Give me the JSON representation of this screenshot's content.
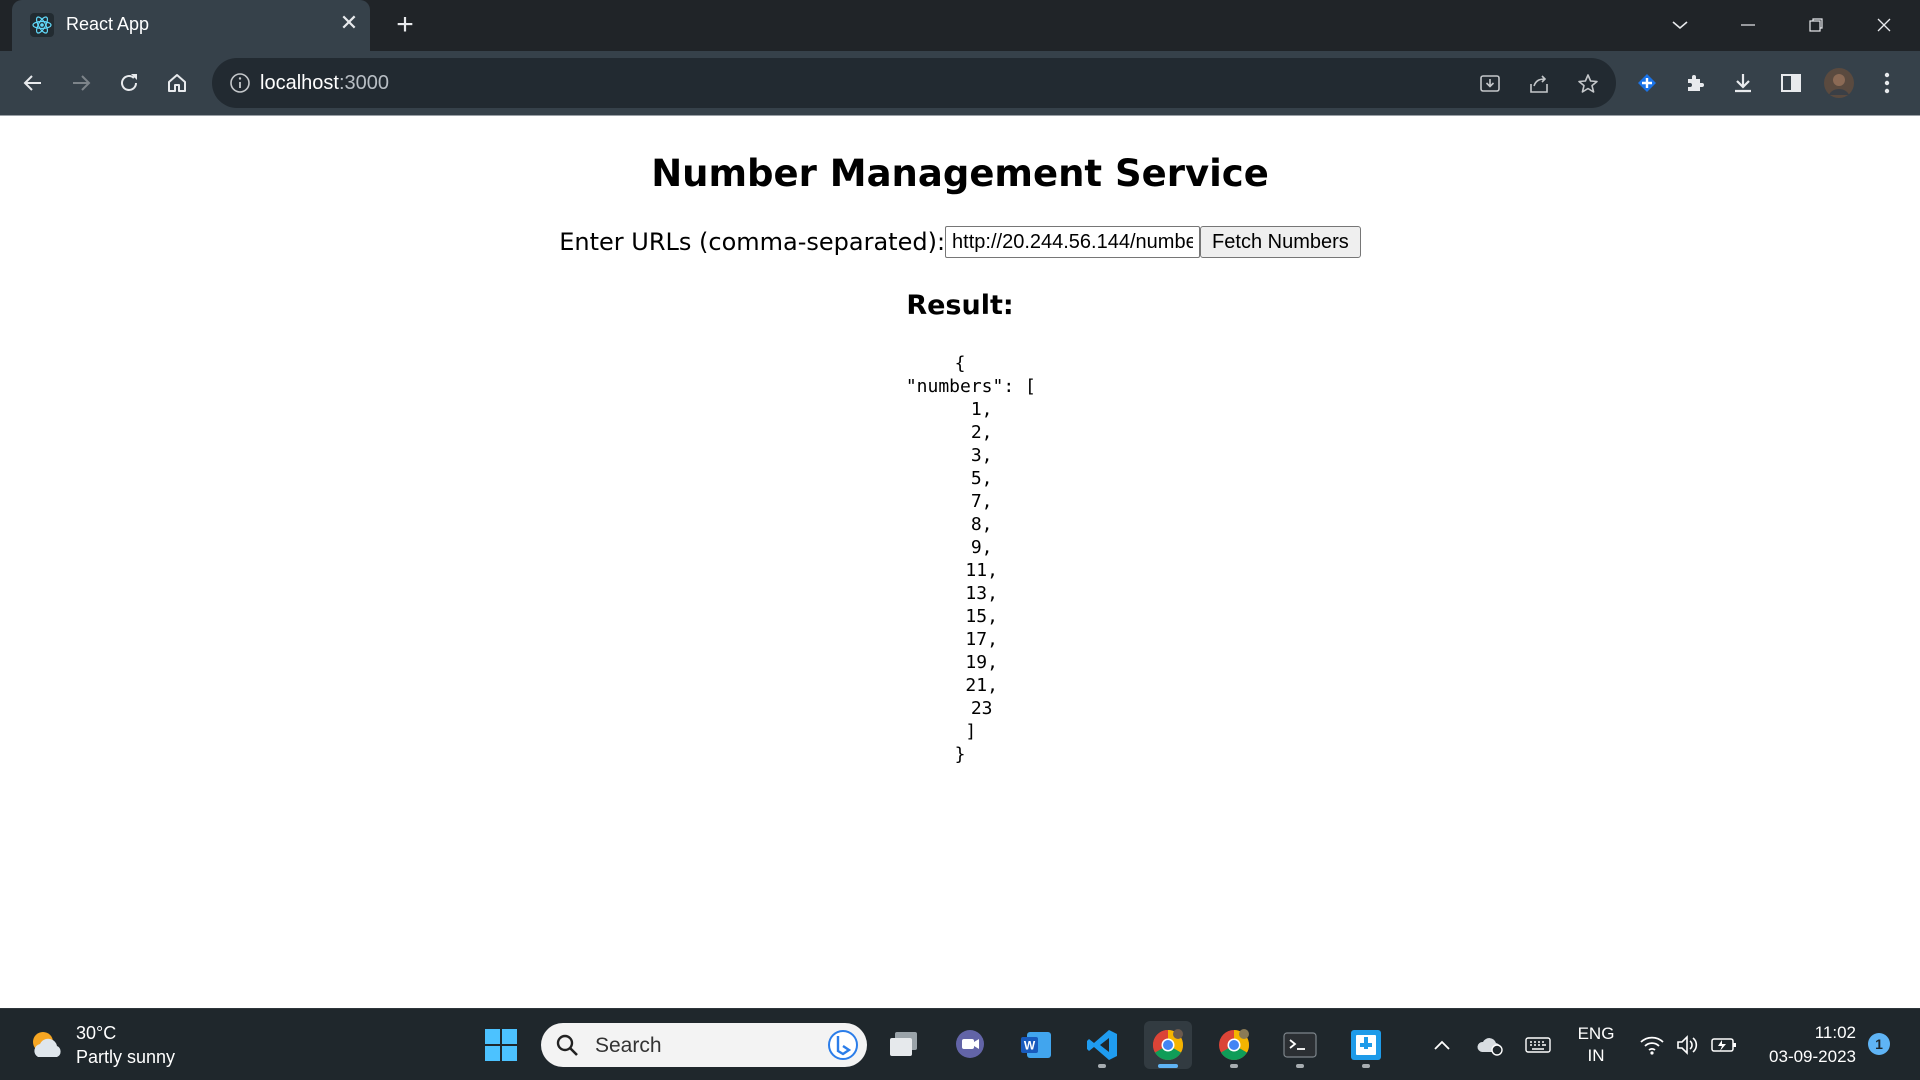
{
  "browser": {
    "tab_title": "React App",
    "url_host": "localhost",
    "url_port": ":3000"
  },
  "page": {
    "title": "Number Management Service",
    "input_label": "Enter URLs (comma-separated):",
    "input_value": "http://20.244.56.144/numbe",
    "fetch_button": "Fetch Numbers",
    "result_heading": "Result:",
    "result_json": "{\n  \"numbers\": [\n    1,\n    2,\n    3,\n    5,\n    7,\n    8,\n    9,\n    11,\n    13,\n    15,\n    17,\n    19,\n    21,\n    23\n  ]\n}"
  },
  "taskbar": {
    "weather_temp": "30°C",
    "weather_desc": "Partly sunny",
    "search_placeholder": "Search",
    "lang_line1": "ENG",
    "lang_line2": "IN",
    "time": "11:02",
    "date": "03-09-2023",
    "notification_count": "1"
  },
  "colors": {
    "tabstrip": "#202428",
    "toolbar": "#36414a",
    "omnibox": "#222a31",
    "taskbar": "#1f272c",
    "accent": "#5fb4f5"
  }
}
